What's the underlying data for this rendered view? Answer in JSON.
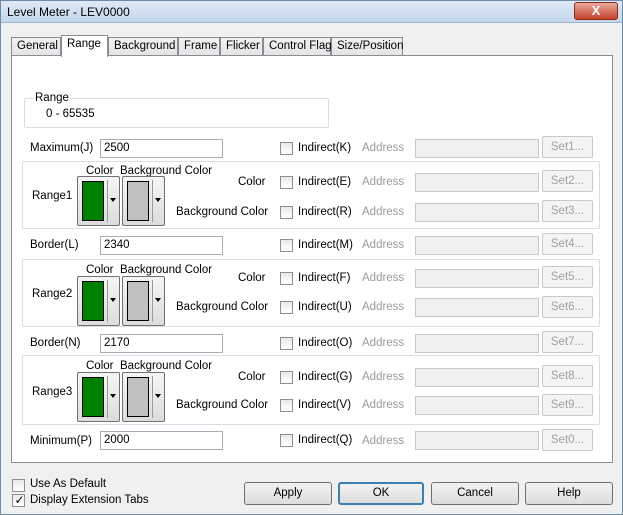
{
  "window": {
    "title": "Level Meter - LEV0000",
    "close_glyph": "X"
  },
  "tabs": [
    {
      "label": "General"
    },
    {
      "label": "Range"
    },
    {
      "label": "Background"
    },
    {
      "label": "Frame"
    },
    {
      "label": "Flicker"
    },
    {
      "label": "Control Flag"
    },
    {
      "label": "Size/Position"
    }
  ],
  "active_tab": "Range",
  "range_group": {
    "title": "Range",
    "value": "0 - 65535"
  },
  "labels": {
    "address": "Address",
    "color": "Color",
    "background_color": "Background Color"
  },
  "maximum": {
    "label": "Maximum(J)",
    "value": "2500",
    "indirect": "Indirect(K)",
    "set": "Set1..."
  },
  "range1": {
    "label": "Range1",
    "color": "#008000",
    "bg_color": "#c0c0c0",
    "color_indirect": "Indirect(E)",
    "color_set": "Set2...",
    "bg_indirect": "Indirect(R)",
    "bg_set": "Set3..."
  },
  "border_l": {
    "label": "Border(L)",
    "value": "2340",
    "indirect": "Indirect(M)",
    "set": "Set4..."
  },
  "range2": {
    "label": "Range2",
    "color": "#008000",
    "bg_color": "#c0c0c0",
    "color_indirect": "Indirect(F)",
    "color_set": "Set5...",
    "bg_indirect": "Indirect(U)",
    "bg_set": "Set6..."
  },
  "border_n": {
    "label": "Border(N)",
    "value": "2170",
    "indirect": "Indirect(O)",
    "set": "Set7..."
  },
  "range3": {
    "label": "Range3",
    "color": "#008000",
    "bg_color": "#c0c0c0",
    "color_indirect": "Indirect(G)",
    "color_set": "Set8...",
    "bg_indirect": "Indirect(V)",
    "bg_set": "Set9..."
  },
  "minimum": {
    "label": "Minimum(P)",
    "value": "2000",
    "indirect": "Indirect(Q)",
    "set": "Set0..."
  },
  "footer": {
    "use_as_default": {
      "label": "Use As Default",
      "checked": false
    },
    "display_extension_tabs": {
      "label": "Display Extension Tabs",
      "checked": true
    },
    "check_glyph": "✓",
    "buttons": {
      "apply": "Apply",
      "ok": "OK",
      "cancel": "Cancel",
      "help": "Help"
    }
  }
}
